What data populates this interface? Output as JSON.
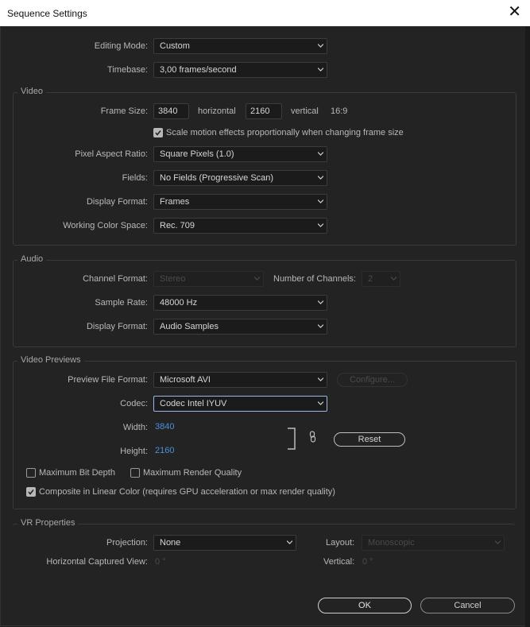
{
  "window": {
    "title": "Sequence Settings",
    "close": "✕"
  },
  "editing_mode": {
    "label": "Editing Mode:",
    "value": "Custom"
  },
  "timebase": {
    "label": "Timebase:",
    "value": "3,00  frames/second"
  },
  "video": {
    "title": "Video",
    "frame_size": {
      "label": "Frame Size:",
      "width": "3840",
      "horizontal": "horizontal",
      "height": "2160",
      "vertical": "vertical",
      "ratio": "16:9"
    },
    "scale_motion": {
      "label": "Scale motion effects proportionally when changing frame size",
      "checked": true
    },
    "pixel_aspect": {
      "label": "Pixel Aspect Ratio:",
      "value": "Square Pixels (1.0)"
    },
    "fields": {
      "label": "Fields:",
      "value": "No Fields (Progressive Scan)"
    },
    "display_format": {
      "label": "Display Format:",
      "value": "Frames"
    },
    "color_space": {
      "label": "Working Color Space:",
      "value": "Rec. 709"
    }
  },
  "audio": {
    "title": "Audio",
    "channel_format": {
      "label": "Channel Format:",
      "value": "Stereo"
    },
    "num_channels": {
      "label": "Number of Channels:",
      "value": "2"
    },
    "sample_rate": {
      "label": "Sample Rate:",
      "value": "48000 Hz"
    },
    "display_format": {
      "label": "Display Format:",
      "value": "Audio Samples"
    }
  },
  "previews": {
    "title": "Video Previews",
    "file_format": {
      "label": "Preview File Format:",
      "value": "Microsoft AVI"
    },
    "configure": "Configure...",
    "codec": {
      "label": "Codec:",
      "value": "Codec Intel IYUV"
    },
    "width": {
      "label": "Width:",
      "value": "3840"
    },
    "height": {
      "label": "Height:",
      "value": "2160"
    },
    "reset": "Reset",
    "max_bit_depth": {
      "label": "Maximum Bit Depth",
      "checked": false
    },
    "max_render": {
      "label": "Maximum Render Quality",
      "checked": false
    },
    "composite": {
      "label": "Composite in Linear Color (requires GPU acceleration or max render quality)",
      "checked": true
    }
  },
  "vr": {
    "title": "VR Properties",
    "projection": {
      "label": "Projection:",
      "value": "None"
    },
    "layout": {
      "label": "Layout:",
      "value": "Monoscopic"
    },
    "captured_view": {
      "label": "Horizontal Captured View:",
      "value": "0 °"
    },
    "vertical": {
      "label": "Vertical:",
      "value": "0 °"
    }
  },
  "buttons": {
    "ok": "OK",
    "cancel": "Cancel"
  }
}
